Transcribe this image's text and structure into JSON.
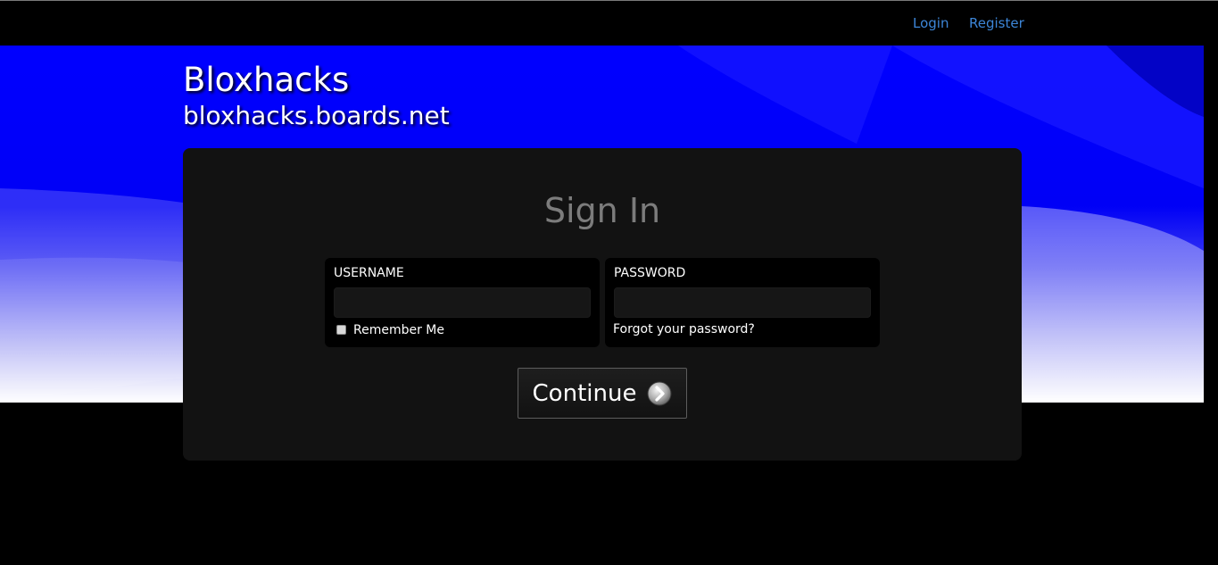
{
  "nav": {
    "login": "Login",
    "register": "Register"
  },
  "site": {
    "title": "Bloxhacks",
    "subtitle": "bloxhacks.boards.net"
  },
  "signin": {
    "heading": "Sign In",
    "username_label": "USERNAME",
    "username_value": "",
    "password_label": "PASSWORD",
    "password_value": "",
    "remember_label": "Remember Me",
    "remember_checked": false,
    "forgot_label": "Forgot your password?",
    "continue_label": "Continue",
    "continue_icon": "chevron-right-circle-icon"
  },
  "colors": {
    "nav_link": "#3d86d8",
    "banner_blue": "#0000ff",
    "panel_bg": "#121212"
  }
}
